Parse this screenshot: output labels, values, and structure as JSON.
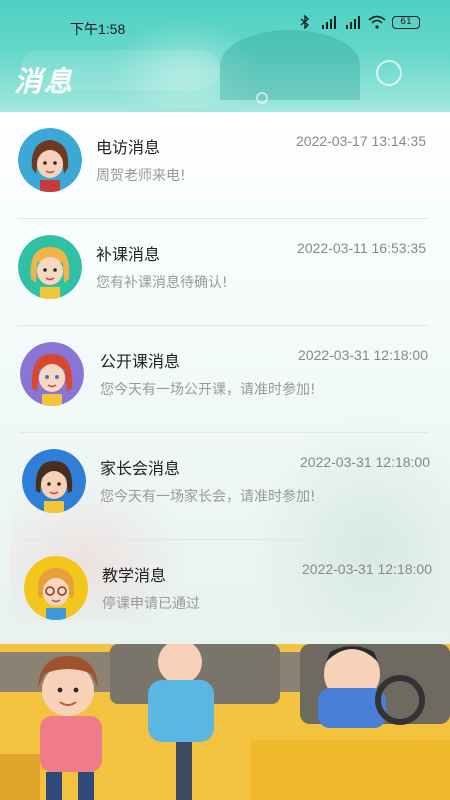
{
  "status_bar": {
    "time": "下午1:58",
    "battery": "61"
  },
  "page": {
    "title": "消息"
  },
  "messages": [
    {
      "title": "电访消息",
      "timestamp": "2022-03-17 13:14:35",
      "description": "周贺老师来电!",
      "avatar_icon": "girl-brown-hair-avatar-icon",
      "avatar_bg": "#3ba8d8"
    },
    {
      "title": "补课消息",
      "timestamp": "2022-03-11 16:53:35",
      "description": "您有补课消息待确认!",
      "avatar_icon": "girl-blonde-avatar-icon",
      "avatar_bg": "#2fc1a6"
    },
    {
      "title": "公开课消息",
      "timestamp": "2022-03-31 12:18:00",
      "description": "您今天有一场公开课，请准时参加!",
      "avatar_icon": "girl-red-hair-avatar-icon",
      "avatar_bg": "#8a75d6"
    },
    {
      "title": "家长会消息",
      "timestamp": "2022-03-31 12:18:00",
      "description": "您今天有一场家长会，请准时参加!",
      "avatar_icon": "girl-dark-hair-avatar-icon",
      "avatar_bg": "#2f7fd8"
    },
    {
      "title": "教学消息",
      "timestamp": "2022-03-31 12:18:00",
      "description": "停课申请已通过",
      "avatar_icon": "girl-glasses-avatar-icon",
      "avatar_bg": "#f2c61a"
    }
  ]
}
